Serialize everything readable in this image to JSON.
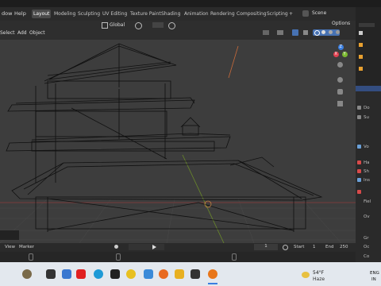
{
  "menu": {
    "items": [
      "dow",
      "Help"
    ]
  },
  "workspace_tabs": [
    "Layout",
    "Modeling",
    "Sculpting",
    "UV Editing",
    "Texture Paint",
    "Shading",
    "Animation",
    "Rendering",
    "Compositing",
    "Scripting"
  ],
  "add_tab_label": "+",
  "scene_label": "Scene",
  "viewport_header": {
    "select": "Select",
    "add": "Add",
    "object": "Object",
    "orientation": "Global",
    "options": "Options"
  },
  "gizmo": {
    "x": "X",
    "y": "Y",
    "z": "Z"
  },
  "timeline_header": {
    "view": "View",
    "marker": "Marker"
  },
  "timeline": {
    "current_frame": "1",
    "start_label": "Start",
    "start_value": "1",
    "end_label": "End",
    "end_value": "250"
  },
  "properties_labels": [
    "Do",
    "Su",
    "Vo",
    "Ha",
    "Sh",
    "Ins",
    "Fiel",
    "Ov",
    "Gr",
    "Oc",
    "Co"
  ],
  "weather": {
    "temp": "54°F",
    "condition": "Haze"
  },
  "tray": {
    "lang1": "ENG",
    "lang2": "IN"
  },
  "colors": {
    "accent": "#4772b3",
    "active_tab": "#4a4a4a",
    "gizmo_x": "#e04050",
    "gizmo_y": "#7bb830",
    "gizmo_z": "#3a7ee0"
  }
}
